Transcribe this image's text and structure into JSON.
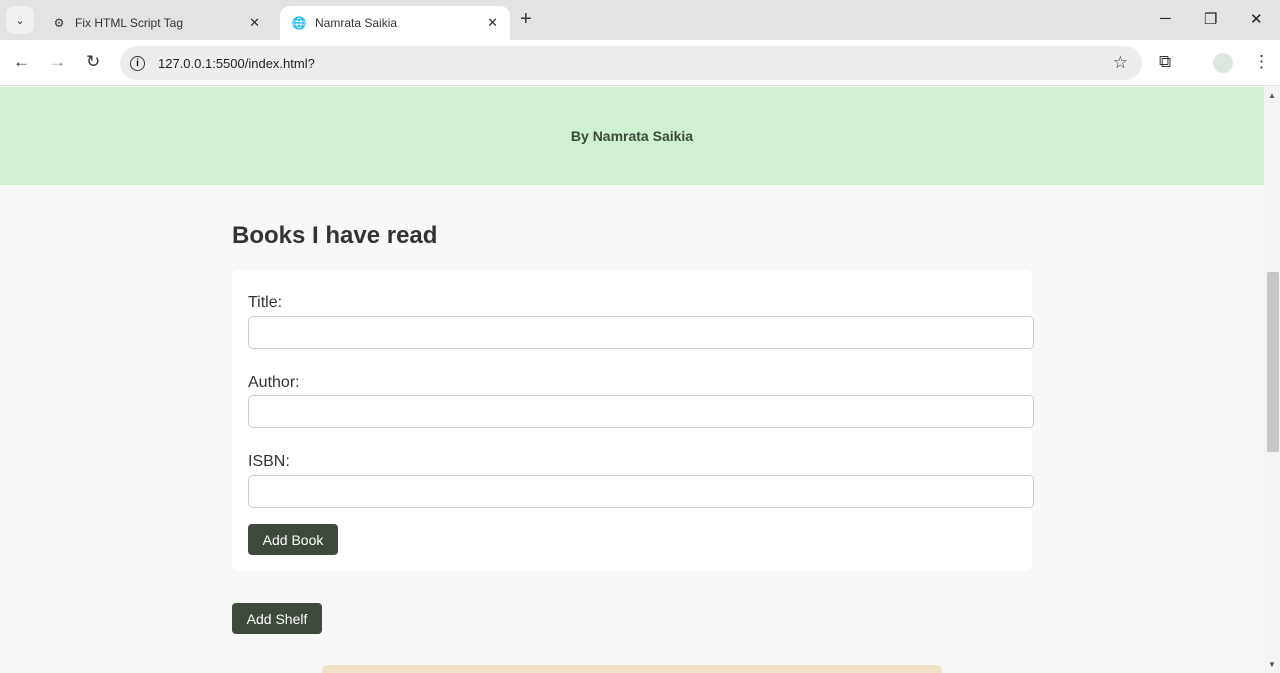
{
  "browser": {
    "tabs": [
      {
        "title": "Fix HTML Script Tag",
        "icon": "openai-icon"
      },
      {
        "title": "Namrata Saikia",
        "icon": "globe-icon"
      }
    ],
    "url": "127.0.0.1:5500/index.html?"
  },
  "header": {
    "byline": "By Namrata Saikia"
  },
  "main": {
    "heading": "Books I have read",
    "form": {
      "title_label": "Title:",
      "author_label": "Author:",
      "isbn_label": "ISBN:",
      "title_value": "",
      "author_value": "",
      "isbn_value": "",
      "add_book": "Add Book"
    },
    "add_shelf": "Add Shelf"
  }
}
